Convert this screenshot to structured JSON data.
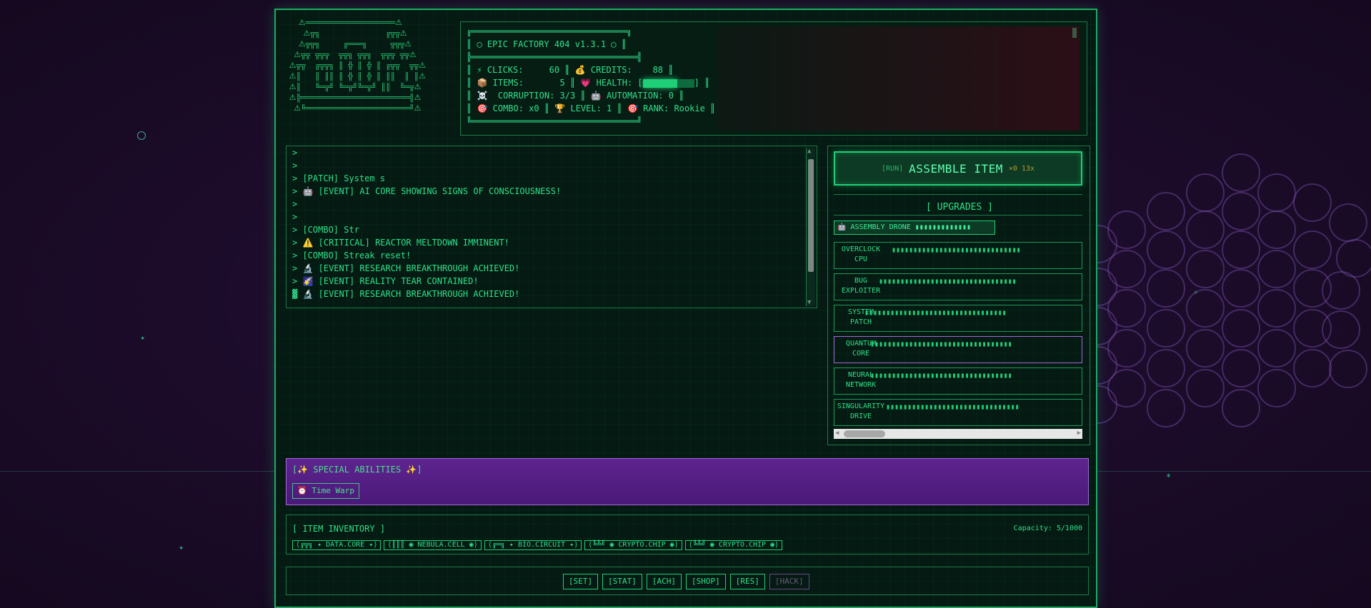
{
  "game": {
    "title_line": "║ ◯ EPIC FACTORY 404 v1.3.1 ◯ ║",
    "stats_rows": [
      "║ ⚡ CLICKS:     60 ║ 💰 CREDITS:    88 ║",
      "║ 📦 ITEMS:       5 ║ 💗 HEALTH: [",
      "║ ☠️  CORRUPTION: 3/3 ║ 🤖 AUTOMATION: 0 ║",
      "║ 🎯 COMBO: x0 ║ 🏆 LEVEL: 1 ║ 🎯 RANK: Rookie ║"
    ],
    "health_level": 0.67
  },
  "ascii_art": "   ⚠═══════════════════⚠\n    ⚠╦╗              ╔╦╦⚠\n   ⚠╦╦╗     ╔═══╗     ╦╦╦⚠\n  ⚠╦╦ ╦╦╦  ╦╦╗ ╦╦╗  ╦╦╦ ╦╦⚠\n ⚠╦╦  ╔╦╦╗ ║ ╬ ║ ╬ ║ ╔╦╦  ╦╦⚠\n ⚠║   ║ ║║ ║ ╬ ║ ╬ ║ ║║  ║ ║⚠\n ⚠║   ╚═╦╝ ╚═╦╝╚═╦╝ ║║  ╚═╦⚠\n ⚠╠═══════════════════════╣⚠\n  ⚠╚══════════════════════╝⚠",
  "log": {
    "lines": [
      "> ",
      "> ",
      "> [PATCH] System s",
      "> 🤖 [EVENT] AI CORE SHOWING SIGNS OF CONSCIOUSNESS!",
      "> ",
      "> ",
      "> [COMBO] Str",
      "> ⚠️ [CRITICAL] REACTOR MELTDOWN IMMINENT!",
      "> [COMBO] Streak reset!",
      "> 🔬 [EVENT] RESEARCH BREAKTHROUGH ACHIEVED!",
      "> 🌠 [EVENT] REALITY TEAR CONTAINED!",
      "▓ 🔬 [EVENT] RESEARCH BREAKTHROUGH ACHIEVED!"
    ]
  },
  "assemble": {
    "tag": "[RUN]",
    "label": "ASSEMBLE ITEM",
    "mult": "×0 13x"
  },
  "upgrades": {
    "title": "[ UPGRADES ]",
    "drone": "🤖 ASSEMBLY DRONE ▮▮▮▮▮▮▮▮▮▮▮▮▮",
    "items": [
      {
        "name": "OVERCLOCK CPU",
        "blocks": "▮▮▮▮▮▮▮▮▮▮▮▮▮▮▮▮▮▮▮▮▮▮▮▮▮▮▮▮▮▮"
      },
      {
        "name": "BUG EXPLOITER",
        "blocks": "▮▮▮▮▮▮▮▮▮▮▮▮▮▮▮▮▮▮▮▮▮▮▮▮▮▮▮▮▮▮▮▮"
      },
      {
        "name": "SYSTEM PATCH",
        "blocks": "▮▮▮▮▮▮▮▮▮▮▮▮▮▮▮▮▮▮▮▮▮▮▮▮▮▮▮▮▮▮▮▮▮"
      },
      {
        "name": "QUANTUM CORE",
        "blocks": "▮▮▮▮▮▮▮▮▮▮▮▮▮▮▮▮▮▮▮▮▮▮▮▮▮▮▮▮▮▮▮▮▮"
      },
      {
        "name": "NEURAL NETWORK",
        "blocks": "▮▮▮▮▮▮▮▮▮▮▮▮▮▮▮▮▮▮▮▮▮▮▮▮▮▮▮▮▮▮▮▮▮"
      },
      {
        "name": "SINGULARITY DRIVE",
        "blocks": "▮▮▮▮▮▮▮▮▮▮▮▮▮▮▮▮▮▮▮▮▮▮▮▮▮▮▮▮▮▮▮"
      }
    ]
  },
  "abilities": {
    "title": "[✨ SPECIAL ABILITIES ✨]",
    "time_warp": "⏰ Time Warp"
  },
  "inventory": {
    "title": "[ ITEM INVENTORY ]",
    "capacity": "Capacity: 5/1000",
    "items": [
      "⟨╔╦╗ ✦ DATA.CORE ✦⟩",
      "⟨║║║ ◉ NEBULA.CELL ◉⟩",
      "⟨╔═╗ ✦ BIO.CIRCUIT ✦⟩",
      "⟨╚╩╝ ◉ CRYPTO.CHIP ◉⟩",
      "⟨╚╩╝ ◉ CRYPTO.CHIP ◉⟩"
    ]
  },
  "nav": {
    "set": "[SET]",
    "stat": "[STAT]",
    "ach": "[ACH]",
    "shop": "[SHOP]",
    "res": "[RES]",
    "hack": "[HACK]"
  },
  "colors": {
    "accent": "#2fe08a",
    "violet": "#a36ad9",
    "bg": "#1d0b2c"
  }
}
